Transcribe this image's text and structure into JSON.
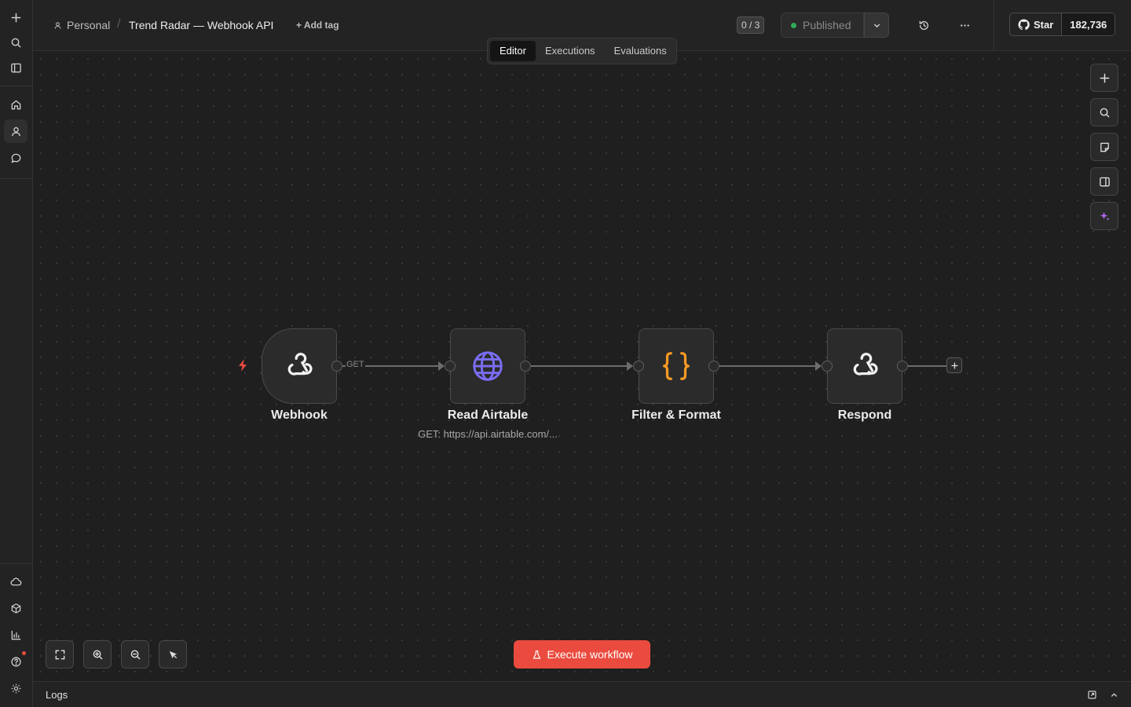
{
  "sidebar": {
    "top_icons": [
      "plus-icon",
      "search-icon",
      "panel-icon"
    ],
    "nav_icons": [
      "home-icon",
      "user-icon",
      "chat-icon"
    ],
    "bottom_icons": [
      "cloud-icon",
      "package-icon",
      "chart-icon",
      "help-icon",
      "settings-icon"
    ]
  },
  "header": {
    "project": "Personal",
    "separator": "/",
    "workflow_title": "Trend Radar — Webhook API",
    "add_tag": "+ Add tag",
    "step_count": "0 / 3",
    "status": "Published",
    "status_color": "#2eaa5a",
    "github": {
      "star_label": "Star",
      "star_count": "182,736"
    }
  },
  "tabs": [
    {
      "label": "Editor",
      "active": true
    },
    {
      "label": "Executions",
      "active": false
    },
    {
      "label": "Evaluations",
      "active": false
    }
  ],
  "workflow": {
    "nodes": [
      {
        "label": "Webhook",
        "icon": "webhook-icon",
        "subtitle": ""
      },
      {
        "label": "Read Airtable",
        "icon": "globe-icon",
        "subtitle": "GET: https://api.airtable.com/..."
      },
      {
        "label": "Filter & Format",
        "icon": "code-braces-icon",
        "subtitle": ""
      },
      {
        "label": "Respond",
        "icon": "webhook-icon",
        "subtitle": ""
      }
    ],
    "connections": [
      {
        "from": "Webhook",
        "to": "Read Airtable",
        "label": "GET"
      },
      {
        "from": "Read Airtable",
        "to": "Filter & Format",
        "label": ""
      },
      {
        "from": "Filter & Format",
        "to": "Respond",
        "label": ""
      }
    ]
  },
  "canvas_tools": [
    "add-node",
    "search",
    "sticky-note",
    "toggle-panel",
    "ai-assistant"
  ],
  "bottom_tools": [
    "fit-view",
    "zoom-in",
    "zoom-out",
    "pointer-mode"
  ],
  "execute_label": "Execute workflow",
  "logs_label": "Logs",
  "colors": {
    "accent": "#ea4b3e",
    "http_icon": "#7b6ef6",
    "code_icon": "#f59a23",
    "ai_icon": "#b06cf2"
  }
}
